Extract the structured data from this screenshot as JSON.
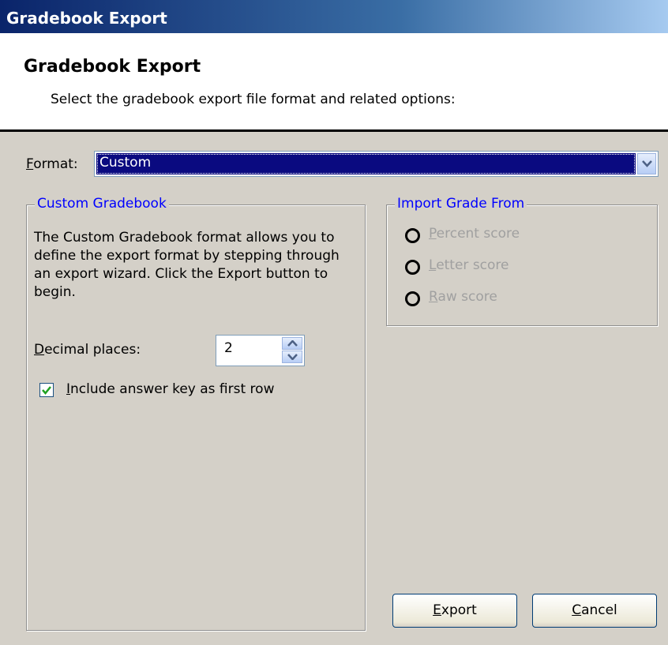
{
  "window": {
    "title": "Gradebook Export"
  },
  "header": {
    "title": "Gradebook Export",
    "subtitle": "Select the gradebook export file format and related options:"
  },
  "format": {
    "label_mnemonic": "F",
    "label_rest": "ormat:",
    "value": "Custom"
  },
  "custom_group": {
    "title": "Custom Gradebook",
    "description": "The Custom Gradebook format allows you to define the export format by stepping through an export wizard. Click the Export button to begin.",
    "decimal_label_mnemonic": "D",
    "decimal_label_rest": "ecimal places:",
    "decimal_value": "2",
    "include_key_mnemonic": "I",
    "include_key_rest": "nclude answer key as first row",
    "include_key_checked": true
  },
  "import_group": {
    "title": "Import Grade From",
    "options": [
      {
        "mnemonic": "P",
        "rest": "ercent score",
        "enabled": false
      },
      {
        "mnemonic": "L",
        "rest": "etter score",
        "enabled": false
      },
      {
        "mnemonic": "R",
        "rest": "aw score",
        "enabled": false
      }
    ]
  },
  "buttons": {
    "export_mnemonic": "E",
    "export_rest": "xport",
    "cancel_mnemonic": "C",
    "cancel_rest": "ancel"
  },
  "colors": {
    "selection": "#0a0a80",
    "group_title": "#0000ff",
    "disabled_text": "#a0a0a0"
  }
}
